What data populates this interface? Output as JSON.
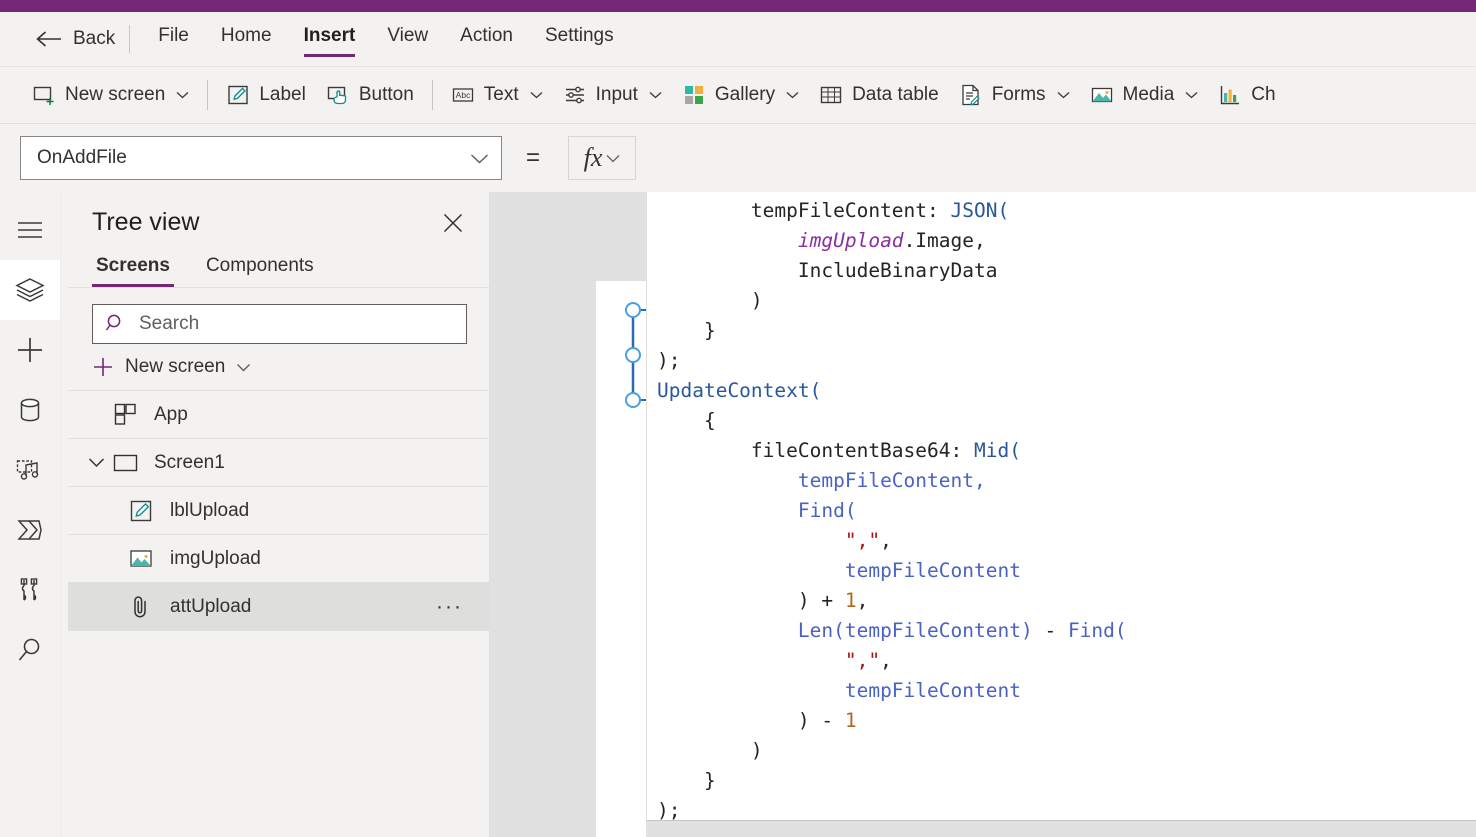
{
  "theme": {
    "brand_purple": "#742774",
    "ribbon_bg": "#f3f2f1",
    "canvas_backdrop": "#e1e1e1",
    "selection_blue": "#2b7cd3"
  },
  "titlebar": {
    "accent_color": "#742774"
  },
  "menu": {
    "back_label": "Back",
    "back_icon": "arrow-left-icon",
    "tabs": [
      {
        "label": "File",
        "active": false
      },
      {
        "label": "Home",
        "active": false
      },
      {
        "label": "Insert",
        "active": true
      },
      {
        "label": "View",
        "active": false
      },
      {
        "label": "Action",
        "active": false
      },
      {
        "label": "Settings",
        "active": false
      }
    ]
  },
  "ribbon": {
    "items": [
      {
        "label": "New screen",
        "icon": "new-screen-icon",
        "chevron": true
      },
      {
        "label": "Label",
        "icon": "label-icon",
        "chevron": false
      },
      {
        "label": "Button",
        "icon": "button-icon",
        "chevron": false
      },
      {
        "label": "Text",
        "icon": "text-abc-icon",
        "chevron": true
      },
      {
        "label": "Input",
        "icon": "input-sliders-icon",
        "chevron": true
      },
      {
        "label": "Gallery",
        "icon": "gallery-icon",
        "chevron": true
      },
      {
        "label": "Data table",
        "icon": "data-table-icon",
        "chevron": false
      },
      {
        "label": "Forms",
        "icon": "forms-icon",
        "chevron": true
      },
      {
        "label": "Media",
        "icon": "media-icon",
        "chevron": true
      },
      {
        "label": "Ch",
        "icon": "charts-icon",
        "chevron": false
      }
    ]
  },
  "formula_bar": {
    "property_value": "OnAddFile",
    "equals_sign": "=",
    "fx_label": "fx",
    "dropdown_icon": "chevron-down-icon"
  },
  "rail": {
    "items": [
      {
        "name": "menu-hamburger",
        "icon": "hamburger-icon",
        "active": false
      },
      {
        "name": "tree-view",
        "icon": "layers-icon",
        "active": true
      },
      {
        "name": "insert",
        "icon": "plus-icon",
        "active": false
      },
      {
        "name": "data",
        "icon": "database-icon",
        "active": false
      },
      {
        "name": "media",
        "icon": "media-note-icon",
        "active": false
      },
      {
        "name": "power-automate",
        "icon": "power-automate-icon",
        "active": false
      },
      {
        "name": "variables",
        "icon": "tools-icon",
        "active": false
      },
      {
        "name": "search",
        "icon": "search-icon",
        "active": false
      }
    ]
  },
  "treeview": {
    "title": "Tree view",
    "close_icon": "close-icon",
    "tabs": [
      {
        "label": "Screens",
        "active": true
      },
      {
        "label": "Components",
        "active": false
      }
    ],
    "search": {
      "placeholder": "Search",
      "value": "",
      "icon": "search-icon"
    },
    "new_screen": {
      "label": "New screen",
      "icon": "plus-icon",
      "chevron_icon": "chevron-down-icon"
    },
    "items": [
      {
        "label": "App",
        "icon": "app-icon",
        "depth": 0,
        "expandable": false,
        "selected": false,
        "overflow": false
      },
      {
        "label": "Screen1",
        "icon": "screen-icon",
        "depth": 0,
        "expandable": true,
        "expanded": true,
        "selected": false,
        "overflow": false
      },
      {
        "label": "lblUpload",
        "icon": "label-icon",
        "depth": 2,
        "expandable": false,
        "selected": false,
        "overflow": false
      },
      {
        "label": "imgUpload",
        "icon": "image-icon",
        "depth": 2,
        "expandable": false,
        "selected": false,
        "overflow": false
      },
      {
        "label": "attUpload",
        "icon": "attachment-icon",
        "depth": 2,
        "expandable": false,
        "selected": true,
        "overflow": true,
        "overflow_label": "···"
      }
    ]
  },
  "formula_editor": {
    "lines": [
      [
        {
          "t": "UpdateContext(",
          "c": "fn"
        }
      ],
      [
        {
          "t": "    {",
          "c": "plain"
        }
      ],
      [
        {
          "t": "        tempFileContent: ",
          "c": "plain"
        },
        {
          "t": "JSON(",
          "c": "fn"
        }
      ],
      [
        {
          "t": "            ",
          "c": "plain"
        },
        {
          "t": "imgUpload",
          "c": "ctrl"
        },
        {
          "t": ".Image,",
          "c": "plain"
        }
      ],
      [
        {
          "t": "            IncludeBinaryData",
          "c": "plain"
        }
      ],
      [
        {
          "t": "        )",
          "c": "plain"
        }
      ],
      [
        {
          "t": "    }",
          "c": "plain"
        }
      ],
      [
        {
          "t": ");",
          "c": "plain"
        }
      ],
      [
        {
          "t": "UpdateContext(",
          "c": "fn"
        }
      ],
      [
        {
          "t": "    {",
          "c": "plain"
        }
      ],
      [
        {
          "t": "        fileContentBase64: ",
          "c": "plain"
        },
        {
          "t": "Mid(",
          "c": "fn"
        }
      ],
      [
        {
          "t": "            ",
          "c": "plain"
        },
        {
          "t": "tempFileContent,",
          "c": "id"
        }
      ],
      [
        {
          "t": "            ",
          "c": "plain"
        },
        {
          "t": "Find(",
          "c": "id"
        }
      ],
      [
        {
          "t": "                ",
          "c": "plain"
        },
        {
          "t": "\",\"",
          "c": "str"
        },
        {
          "t": ",",
          "c": "plain"
        }
      ],
      [
        {
          "t": "                ",
          "c": "plain"
        },
        {
          "t": "tempFileContent",
          "c": "id"
        }
      ],
      [
        {
          "t": "            ) + ",
          "c": "plain"
        },
        {
          "t": "1",
          "c": "num"
        },
        {
          "t": ",",
          "c": "plain"
        }
      ],
      [
        {
          "t": "            ",
          "c": "plain"
        },
        {
          "t": "Len(tempFileContent)",
          "c": "id"
        },
        {
          "t": " - ",
          "c": "plain"
        },
        {
          "t": "Find(",
          "c": "id"
        }
      ],
      [
        {
          "t": "                ",
          "c": "plain"
        },
        {
          "t": "\",\"",
          "c": "str"
        },
        {
          "t": ",",
          "c": "plain"
        }
      ],
      [
        {
          "t": "                ",
          "c": "plain"
        },
        {
          "t": "tempFileContent",
          "c": "id"
        }
      ],
      [
        {
          "t": "            ) - ",
          "c": "plain"
        },
        {
          "t": "1",
          "c": "num"
        }
      ],
      [
        {
          "t": "        )",
          "c": "plain"
        }
      ],
      [
        {
          "t": "    }",
          "c": "plain"
        }
      ],
      [
        {
          "t": ");",
          "c": "plain"
        }
      ]
    ]
  },
  "canvas": {
    "selected_control": "attUpload",
    "handle_color": "#2b7cd3"
  }
}
